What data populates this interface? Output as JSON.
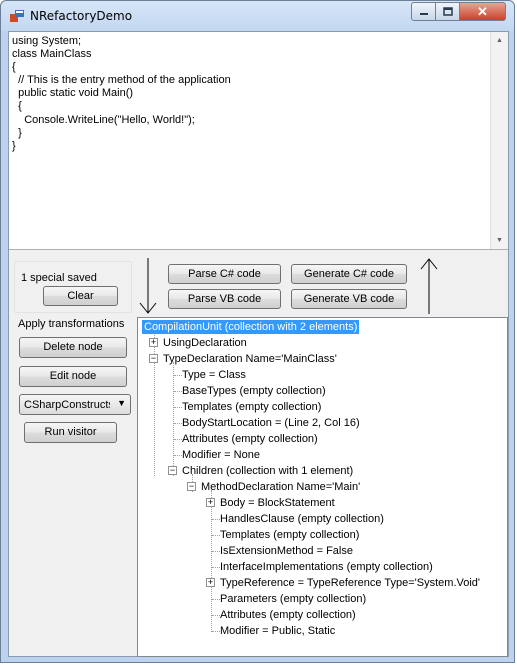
{
  "window": {
    "title": "NRefactoryDemo",
    "controls": {
      "close_glyph": "✕"
    }
  },
  "code_editor": {
    "text": "using System;\nclass MainClass\n{\n  // This is the entry method of the application\n  public static void Main()\n  {\n    Console.WriteLine(\"Hello, World!\");\n  }\n}"
  },
  "special": {
    "status": "1 special saved",
    "clear_label": "Clear"
  },
  "buttons": {
    "parse_cs": "Parse C# code",
    "generate_cs": "Generate C# code",
    "parse_vb": "Parse VB code",
    "generate_vb": "Generate VB code"
  },
  "transformations": {
    "heading": "Apply transformations",
    "delete_node": "Delete node",
    "edit_node": "Edit node",
    "visitor_selected": "CSharpConstructsVisitor",
    "run_visitor": "Run visitor"
  },
  "tree": {
    "nodes": [
      "CompilationUnit (collection with 2 elements)",
      "UsingDeclaration",
      "TypeDeclaration Name='MainClass'",
      "Type = Class",
      "BaseTypes (empty collection)",
      "Templates (empty collection)",
      "BodyStartLocation = (Line 2, Col 16)",
      "Attributes (empty collection)",
      "Modifier = None",
      "Children (collection with 1 element)",
      "MethodDeclaration Name='Main'",
      "Body = BlockStatement",
      "HandlesClause (empty collection)",
      "Templates (empty collection)",
      "IsExtensionMethod = False",
      "InterfaceImplementations (empty collection)",
      "TypeReference = TypeReference Type='System.Void'",
      "Parameters (empty collection)",
      "Attributes (empty collection)",
      "Modifier = Public, Static"
    ],
    "expand_collapsed": "+",
    "expand_open": "−"
  },
  "colors": {
    "selection": "#3399ff",
    "titlebar": "#c2d7f1"
  }
}
